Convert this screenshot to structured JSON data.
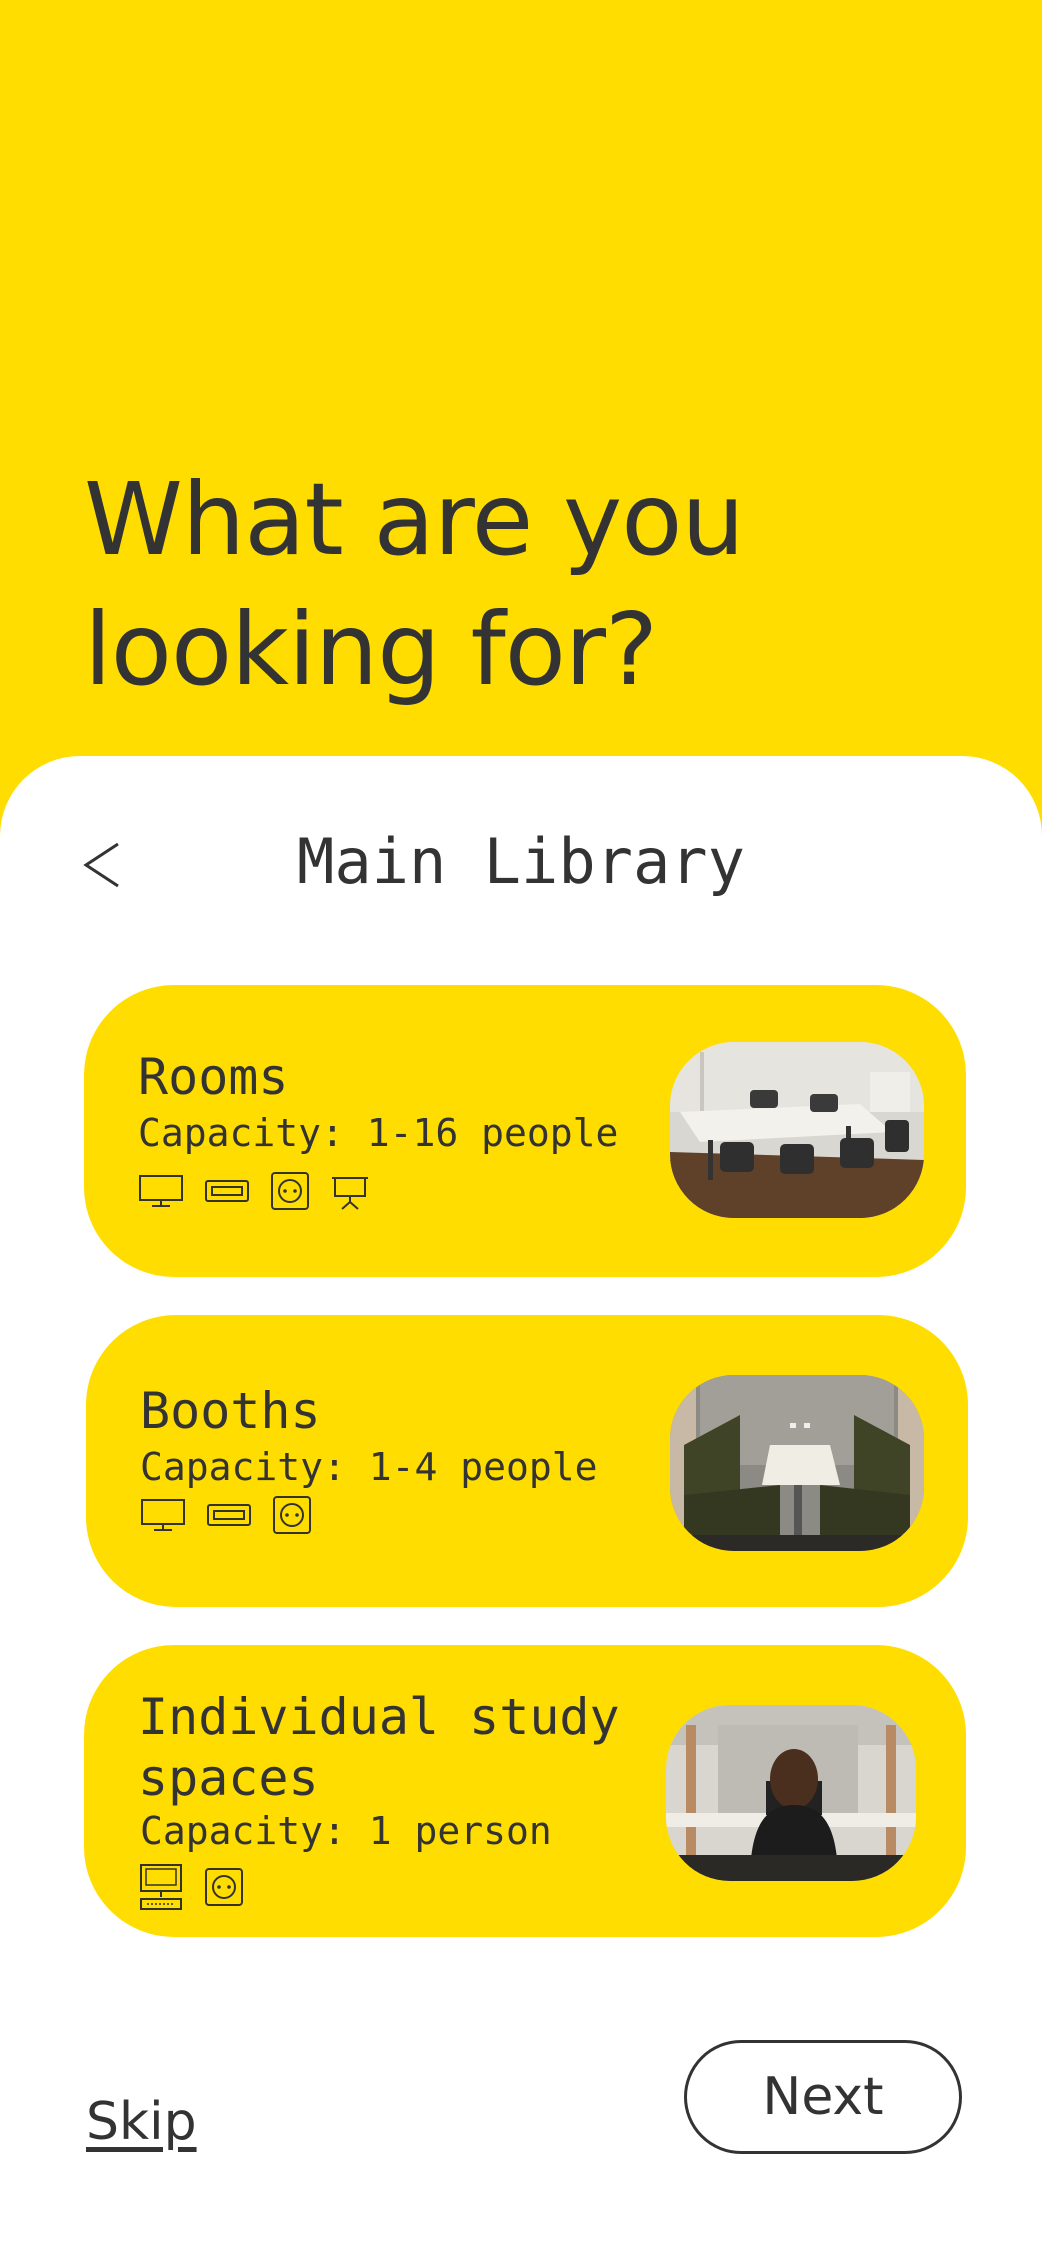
{
  "heading": {
    "line1": "What are you",
    "line2": "looking for?"
  },
  "location": {
    "title": "Main Library",
    "back_icon": "chevron-left-icon"
  },
  "cards": [
    {
      "title": "Rooms",
      "capacity": "Capacity: 1-16 people",
      "amenities": [
        "monitor-icon",
        "hdmi-icon",
        "power-socket-icon",
        "projector-screen-icon"
      ],
      "image": "meeting-room-photo"
    },
    {
      "title": "Booths",
      "capacity": "Capacity: 1-4 people",
      "amenities": [
        "monitor-icon",
        "hdmi-icon",
        "power-socket-icon"
      ],
      "image": "booth-photo"
    },
    {
      "title_line1": "Individual study",
      "title_line2": "spaces",
      "capacity": "Capacity: 1 person",
      "amenities": [
        "desktop-computer-icon",
        "power-socket-icon"
      ],
      "image": "study-desk-photo"
    }
  ],
  "footer": {
    "skip_label": "Skip",
    "next_label": "Next"
  },
  "colors": {
    "accent": "#FFDD00",
    "text": "#333333",
    "surface": "#FFFFFF"
  }
}
